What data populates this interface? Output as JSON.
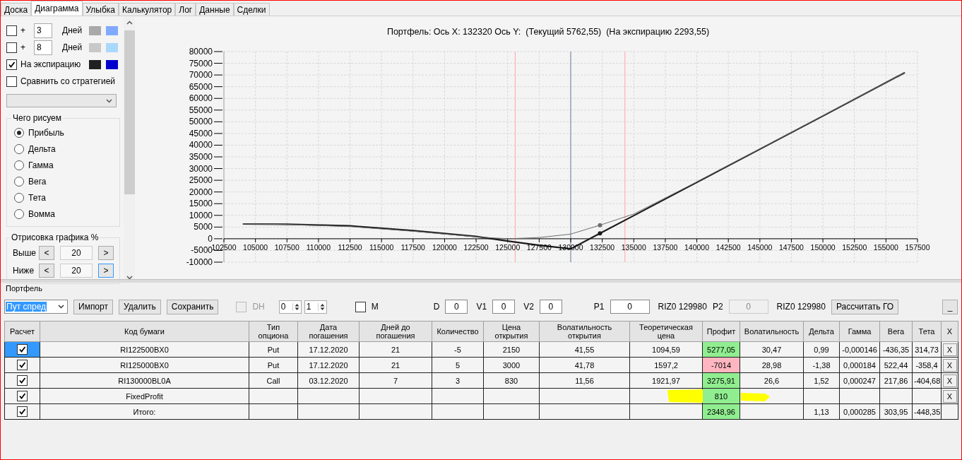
{
  "tabs": [
    {
      "label": "Доска",
      "selected": false
    },
    {
      "label": "Диаграмма",
      "selected": true
    },
    {
      "label": "Улыбка",
      "selected": false
    },
    {
      "label": "Калькулятор",
      "selected": false
    },
    {
      "label": "Лог",
      "selected": false
    },
    {
      "label": "Данные",
      "selected": false
    },
    {
      "label": "Сделки",
      "selected": false
    }
  ],
  "curve_options": [
    {
      "kind": "days",
      "checked": false,
      "sign": "+",
      "days": "3",
      "unit": "Дней",
      "swatches": [
        {
          "color": "#a9a9a9"
        },
        {
          "color": "#80aaff"
        }
      ]
    },
    {
      "kind": "days",
      "checked": false,
      "sign": "+",
      "days": "8",
      "unit": "Дней",
      "swatches": [
        {
          "color": "#c8c8c8"
        },
        {
          "color": "#aad8ff"
        }
      ]
    },
    {
      "kind": "expiration",
      "checked": true,
      "label": "На экспирацию",
      "swatches": [
        {
          "color": "#202020"
        },
        {
          "color": "#0000cc"
        }
      ]
    },
    {
      "kind": "compare",
      "checked": false,
      "label": "Сравнить со стратегией"
    }
  ],
  "draw_group": {
    "title": "Чего рисуем",
    "options": [
      {
        "label": "Прибыль",
        "selected": true
      },
      {
        "label": "Дельта",
        "selected": false
      },
      {
        "label": "Гамма",
        "selected": false
      },
      {
        "label": "Вега",
        "selected": false
      },
      {
        "label": "Тета",
        "selected": false
      },
      {
        "label": "Вомма",
        "selected": false
      }
    ]
  },
  "range_group": {
    "title": "Отрисовка графика %",
    "rows": [
      {
        "label": "Выше",
        "dec": "<",
        "value": "20",
        "inc": ">",
        "focused": false
      },
      {
        "label": "Ниже",
        "dec": "<",
        "value": "20",
        "inc": ">",
        "focused": true
      }
    ]
  },
  "chart": {
    "chart_data": {
      "type": "line",
      "title": "Портфель: Ось X: 132320 Ось Y:  (Текущий 5762,55)  (На экспирацию 2293,55)",
      "x": [
        104000,
        107500,
        112500,
        117500,
        122500,
        125000,
        127500,
        130000,
        132320,
        135000,
        140000,
        145000,
        150000,
        156500
      ],
      "series": [
        {
          "color": "#1a1a1a",
          "values": [
            6300,
            6200,
            5500,
            3500,
            1000,
            -1000,
            -2800,
            -4300,
            2300,
            9900,
            24100,
            38300,
            52500,
            71000
          ]
        },
        {
          "color": "#6e6e6e",
          "values": [
            6300,
            6100,
            5200,
            3200,
            800,
            0,
            500,
            2000,
            5800,
            10600,
            24300,
            38400,
            52600,
            71000
          ]
        }
      ],
      "xlim": [
        102500,
        157500
      ],
      "ylim": [
        -10000,
        80000
      ],
      "grid": true,
      "xticks": [
        102500,
        105000,
        107500,
        110000,
        112500,
        115000,
        117500,
        120000,
        122500,
        125000,
        127500,
        130000,
        132500,
        135000,
        137500,
        140000,
        142500,
        145000,
        147500,
        150000,
        152500,
        155000,
        157500
      ],
      "yticks": [
        -10000,
        -5000,
        0,
        5000,
        10000,
        15000,
        20000,
        25000,
        30000,
        35000,
        40000,
        45000,
        50000,
        55000,
        60000,
        65000,
        70000,
        75000,
        80000
      ],
      "ref_lines": [
        {
          "axis": "x",
          "value": 125600,
          "color": "#ffb0b8"
        },
        {
          "axis": "x",
          "value": 130000,
          "color": "#8090a8"
        },
        {
          "axis": "x",
          "value": 134300,
          "color": "#ffb0b8"
        }
      ]
    }
  },
  "portfolio": {
    "title": "Портфель",
    "strategy": "Пут спред",
    "buttons": [
      "Импорт",
      "Удалить",
      "Сохранить"
    ],
    "dh": {
      "label": "DH",
      "checked": false,
      "disabled": true
    },
    "spinners": [
      "0",
      "1"
    ],
    "m": {
      "label": "M",
      "checked": false
    },
    "fields": [
      {
        "label": "D",
        "value": "0"
      },
      {
        "label": "V1",
        "value": "0"
      },
      {
        "label": "V2",
        "value": "0"
      }
    ],
    "p1": {
      "label": "P1",
      "value": "0",
      "ticker": "RIZ0 129980",
      "disabled": false
    },
    "p2": {
      "label": "P2",
      "value": "0",
      "ticker": "RIZ0 129980",
      "disabled": true
    },
    "calc_button": "Рассчитать ГО",
    "minimize_button": "_"
  },
  "table": {
    "columns": [
      "Расчет",
      "Код бумаги",
      "Тип опциона",
      "Дата погашения",
      "Дней до погашения",
      "Количество",
      "Цена открытия",
      "Волатильность открытия",
      "Теоретическая цена",
      "Профит",
      "Волатильность",
      "Дельта",
      "Гамма",
      "Вега",
      "Тета",
      "X"
    ],
    "rows": [
      {
        "selected": true,
        "checked": true,
        "highlighted": false,
        "cells": [
          null,
          "RI122500BX0",
          "Put",
          "17.12.2020",
          "21",
          "-5",
          "2150",
          "41,55",
          "1094,59",
          {
            "text": "5277,05",
            "color": "#90ee90"
          },
          "30,47",
          "0,99",
          "-0,000146",
          "-436,35",
          "314,73",
          "X"
        ]
      },
      {
        "selected": false,
        "checked": true,
        "highlighted": false,
        "cells": [
          null,
          "RI125000BX0",
          "Put",
          "17.12.2020",
          "21",
          "5",
          "3000",
          "41,78",
          "1597,2",
          {
            "text": "-7014",
            "color": "#ffb6c1"
          },
          "28,98",
          "-1,38",
          "0,000184",
          "522,44",
          "-358,4",
          "X"
        ]
      },
      {
        "selected": false,
        "checked": true,
        "highlighted": false,
        "cells": [
          null,
          "RI130000BL0A",
          "Call",
          "03.12.2020",
          "7",
          "3",
          "830",
          "11,56",
          "1921,97",
          {
            "text": "3275,91",
            "color": "#90ee90"
          },
          "26,6",
          "1,52",
          "0,000247",
          "217,86",
          "-404,68",
          "X"
        ]
      },
      {
        "selected": false,
        "checked": true,
        "highlighted": true,
        "cells": [
          null,
          "FixedProfit",
          null,
          null,
          null,
          null,
          null,
          null,
          null,
          {
            "text": "810",
            "color": "#90ee90"
          },
          null,
          null,
          null,
          null,
          null,
          "X"
        ]
      },
      {
        "selected": false,
        "checked": true,
        "highlighted": false,
        "cells": [
          null,
          "Итого:",
          null,
          null,
          null,
          null,
          null,
          null,
          null,
          {
            "text": "2348,96",
            "color": "#90ee90"
          },
          null,
          "1,13",
          "0,000285",
          "303,95",
          "-448,35",
          null
        ]
      }
    ]
  }
}
